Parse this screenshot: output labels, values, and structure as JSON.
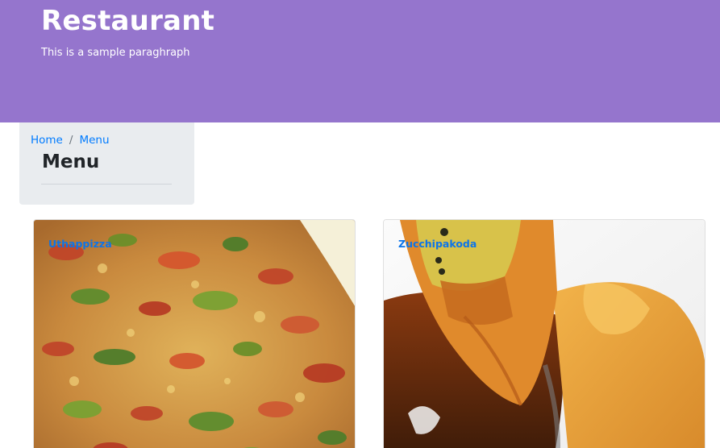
{
  "header": {
    "title": "Restaurant",
    "tagline": "This is a sample paraghraph",
    "background_color": "#9575cd"
  },
  "breadcrumb": {
    "items": [
      {
        "label": "Home"
      },
      {
        "label": "Menu"
      }
    ],
    "separator": "/"
  },
  "page": {
    "heading": "Menu"
  },
  "menu_items": [
    {
      "name": "Uthappizza",
      "image": "pizza-photo"
    },
    {
      "name": "Zucchipakoda",
      "image": "pakoda-photo"
    }
  ],
  "colors": {
    "link": "#007bff",
    "breadcrumb_bg": "#e9ecef"
  }
}
